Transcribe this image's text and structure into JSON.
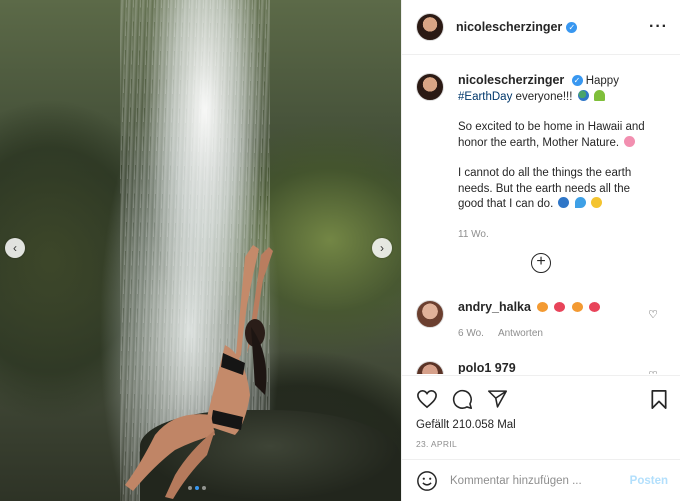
{
  "post": {
    "username": "nicolescherzinger",
    "more_icon": "more-horizontal-icon",
    "caption": {
      "greeting": "Happy",
      "hashtag": "#EarthDay",
      "line1_rest": "everyone!!!",
      "para2": "So excited to be home in Hawaii and honor the earth, Mother Nature.",
      "para3": "I cannot do all the things the earth needs. But the earth needs all the good that I can do.",
      "age": "11 Wo."
    },
    "comments": [
      {
        "username": "andry_halka",
        "age": "6 Wo.",
        "reply_label": "Antworten"
      },
      {
        "username": "polo1 979"
      }
    ],
    "likes": "Gefällt 210.058 Mal",
    "date": "23. APRIL",
    "add_comment": {
      "placeholder": "Kommentar hinzufügen ...",
      "post_label": "Posten"
    }
  },
  "carousel": {
    "slide_count": 3,
    "active_index": 1
  },
  "colors": {
    "accent": "#3897f0",
    "post_disabled": "#b2dffc",
    "hashtag": "#00376b"
  }
}
